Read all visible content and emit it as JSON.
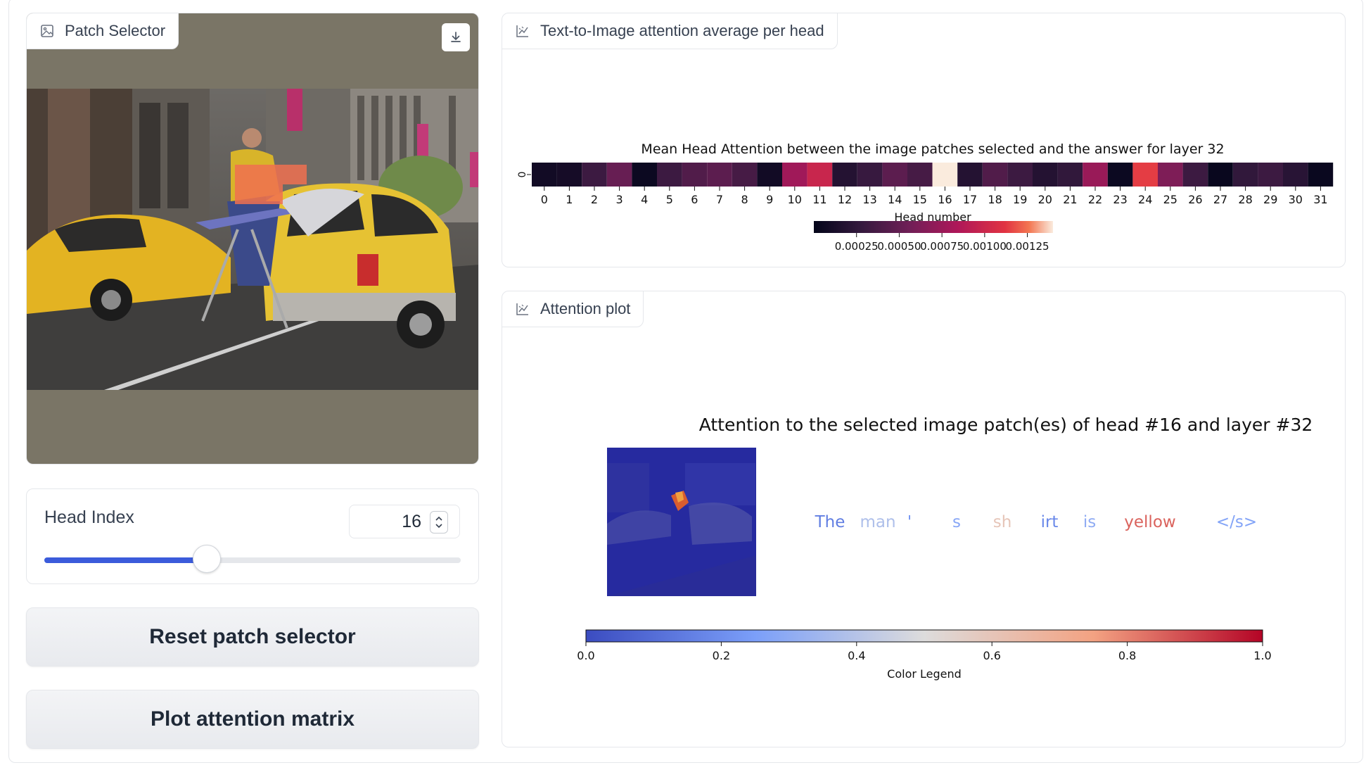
{
  "patch_selector": {
    "label": "Patch Selector",
    "label_icon": "image-icon",
    "download_icon": "download-icon"
  },
  "head_index": {
    "label": "Head Index",
    "value": "16",
    "min": 0,
    "max": 31,
    "slider_fraction": 0.39
  },
  "buttons": {
    "reset": "Reset patch selector",
    "plot": "Plot attention matrix"
  },
  "heatmap_panel": {
    "label": "Text-to-Image attention average per head",
    "label_icon": "chart-icon"
  },
  "attention_panel": {
    "label": "Attention plot",
    "label_icon": "chart-icon"
  },
  "chart_data": [
    {
      "type": "heatmap",
      "title": "Mean Head Attention between the image patches selected and the answer for layer 32",
      "xlabel": "Head number",
      "ylabel": "",
      "y_categories": [
        "0"
      ],
      "x_categories": [
        "0",
        "1",
        "2",
        "3",
        "4",
        "5",
        "6",
        "7",
        "8",
        "9",
        "10",
        "11",
        "12",
        "13",
        "14",
        "15",
        "16",
        "17",
        "18",
        "19",
        "20",
        "21",
        "22",
        "23",
        "24",
        "25",
        "26",
        "27",
        "28",
        "29",
        "30",
        "31"
      ],
      "values": [
        8e-05,
        0.0001,
        0.0003,
        0.0005,
        5e-05,
        0.0003,
        0.0004,
        0.00045,
        0.00035,
        8e-05,
        0.00075,
        0.00095,
        0.00018,
        0.00028,
        0.00045,
        0.00035,
        0.00135,
        0.00018,
        0.0004,
        0.0003,
        0.00018,
        0.00025,
        0.00072,
        5e-05,
        0.0011,
        0.0006,
        0.0003,
        3e-05,
        0.00025,
        0.0003,
        0.0002,
        4e-05
      ],
      "colorbar_ticks": [
        "0.00025",
        "0.00050",
        "0.00075",
        "0.00100",
        "0.00125"
      ],
      "colormap": "rocket"
    },
    {
      "type": "other",
      "title": "Attention to the selected image patch(es) of head #16 and layer #32",
      "tokens": [
        {
          "text": "The",
          "value": 0.15
        },
        {
          "text": "man",
          "value": 0.38
        },
        {
          "text": "'",
          "value": 0.22
        },
        {
          "text": "s",
          "value": 0.28
        },
        {
          "text": "sh",
          "value": 0.6
        },
        {
          "text": "irt",
          "value": 0.18
        },
        {
          "text": "is",
          "value": 0.3
        },
        {
          "text": "yellow",
          "value": 0.85
        },
        {
          "text": "</s>",
          "value": 0.27
        }
      ],
      "colorbar_ticks": [
        "0.0",
        "0.2",
        "0.4",
        "0.6",
        "0.8",
        "1.0"
      ],
      "colorbar_label": "Color Legend",
      "colormap": "coolwarm"
    }
  ]
}
